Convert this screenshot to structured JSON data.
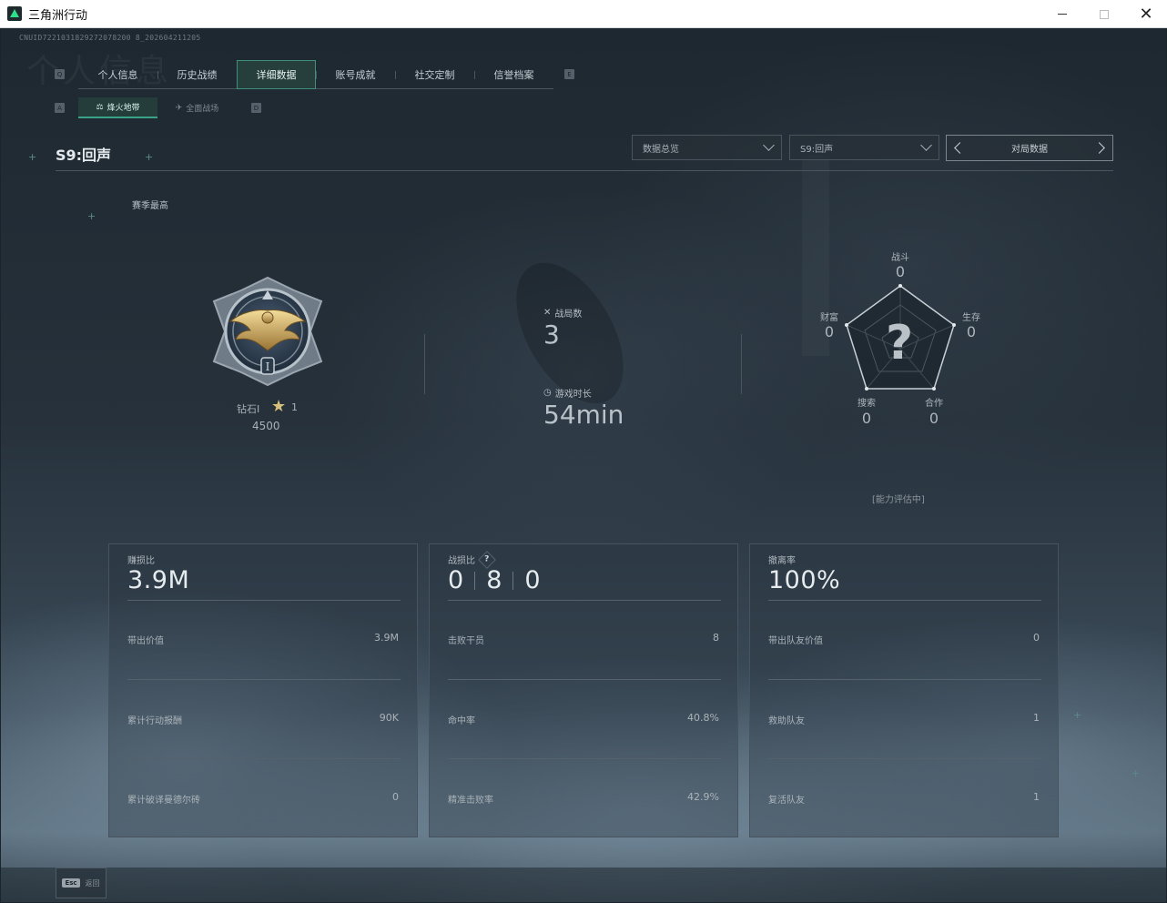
{
  "window": {
    "title": "三角洲行动",
    "minimize": "—",
    "maximize": "□",
    "close": "✕"
  },
  "uid": "CNUID7221031829272078200 8_202604211205",
  "watermark": "个人信息",
  "tabs": {
    "left_key": "Q",
    "right_key": "E",
    "items": [
      {
        "label": "个人信息"
      },
      {
        "label": "历史战绩"
      },
      {
        "label": "详细数据"
      },
      {
        "label": "账号成就"
      },
      {
        "label": "社交定制"
      },
      {
        "label": "信誉档案"
      }
    ]
  },
  "subtabs": {
    "left_key": "A",
    "right_key": "D",
    "items": [
      {
        "label": "烽火地带"
      },
      {
        "label": "全面战场"
      }
    ]
  },
  "season": {
    "title": "S9:回声",
    "dropdown_overview": "数据总览",
    "dropdown_season": "S9:回声",
    "pager_label": "对局数据",
    "best_label": "赛季最高"
  },
  "rank": {
    "name": "钻石I",
    "stars": "1",
    "score": "4500"
  },
  "match_stats": {
    "matches_label": "战局数",
    "matches_value": "3",
    "time_label": "游戏时长",
    "time_value": "54min"
  },
  "radar": {
    "combat_label": "战斗",
    "combat_value": "0",
    "survival_label": "生存",
    "survival_value": "0",
    "wealth_label": "财富",
    "wealth_value": "0",
    "search_label": "搜索",
    "search_value": "0",
    "teamwork_label": "合作",
    "teamwork_value": "0",
    "center_mark": "?",
    "status": "[能力评估中]"
  },
  "cards": [
    {
      "title": "赚损比",
      "value": "3.9M",
      "rows": [
        {
          "label": "带出价值",
          "value": "3.9M"
        },
        {
          "label": "累计行动报酬",
          "value": "90K"
        },
        {
          "label": "累计破译曼德尔砖",
          "value": "0"
        }
      ]
    },
    {
      "title": "战损比",
      "help": "?",
      "kd": [
        "0",
        "8",
        "0"
      ],
      "rows": [
        {
          "label": "击败干员",
          "value": "8"
        },
        {
          "label": "命中率",
          "value": "40.8%"
        },
        {
          "label": "精准击败率",
          "value": "42.9%"
        }
      ]
    },
    {
      "title": "撤离率",
      "value": "100%",
      "rows": [
        {
          "label": "带出队友价值",
          "value": "0"
        },
        {
          "label": "救助队友",
          "value": "1"
        },
        {
          "label": "复活队友",
          "value": "1"
        }
      ]
    }
  ],
  "footer": {
    "esc_key": "Esc",
    "esc_label": "返回"
  },
  "colors": {
    "accent": "#3aa286",
    "background": "#1e2830",
    "text": "#c9d1d8"
  }
}
